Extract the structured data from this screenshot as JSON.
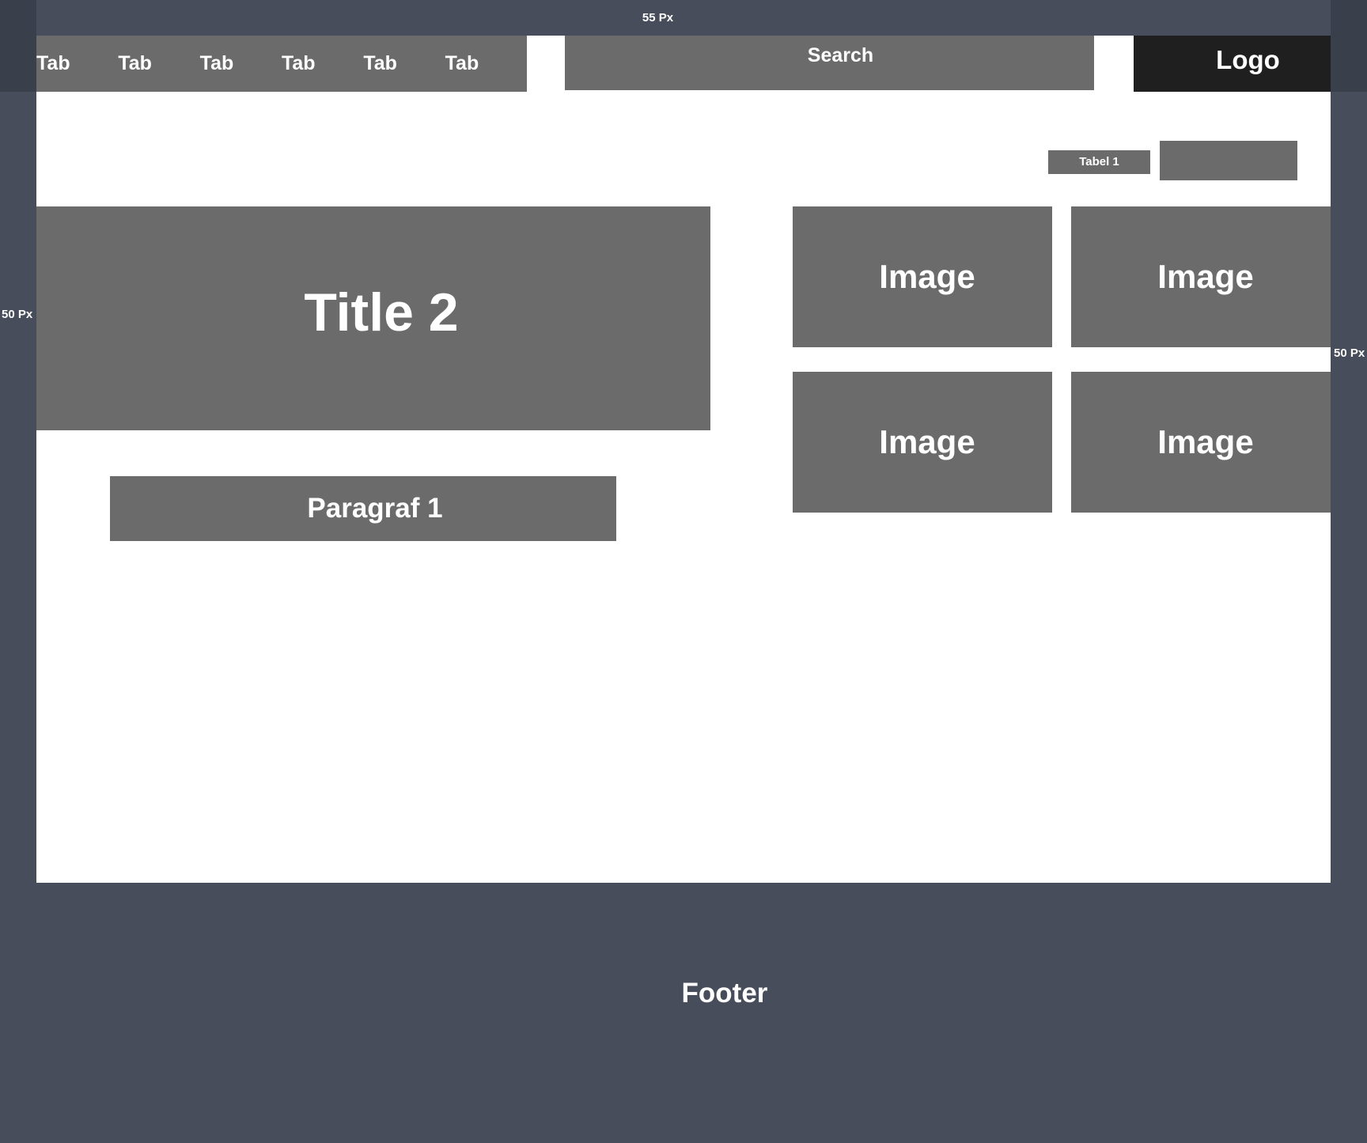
{
  "annotations": {
    "top": "55 Px",
    "left": "50 Px",
    "right": "50 Px"
  },
  "header": {
    "tabs": [
      {
        "label": "Tab"
      },
      {
        "label": "Tab"
      },
      {
        "label": "Tab"
      },
      {
        "label": "Tab"
      },
      {
        "label": "Tab"
      },
      {
        "label": "Tab"
      }
    ],
    "search_label": "Search",
    "logo": "Logo"
  },
  "main": {
    "table_label": "Tabel 1",
    "title": "Title 2",
    "paragraph": "Paragraf 1",
    "images": [
      {
        "label": "Image"
      },
      {
        "label": "Image"
      },
      {
        "label": "Image"
      },
      {
        "label": "Image"
      }
    ]
  },
  "footer": {
    "label": "Footer"
  },
  "colors": {
    "background": "#474d5a",
    "panel": "#6b6b6b",
    "logo": "#1f1f1f",
    "content": "#ffffff"
  }
}
